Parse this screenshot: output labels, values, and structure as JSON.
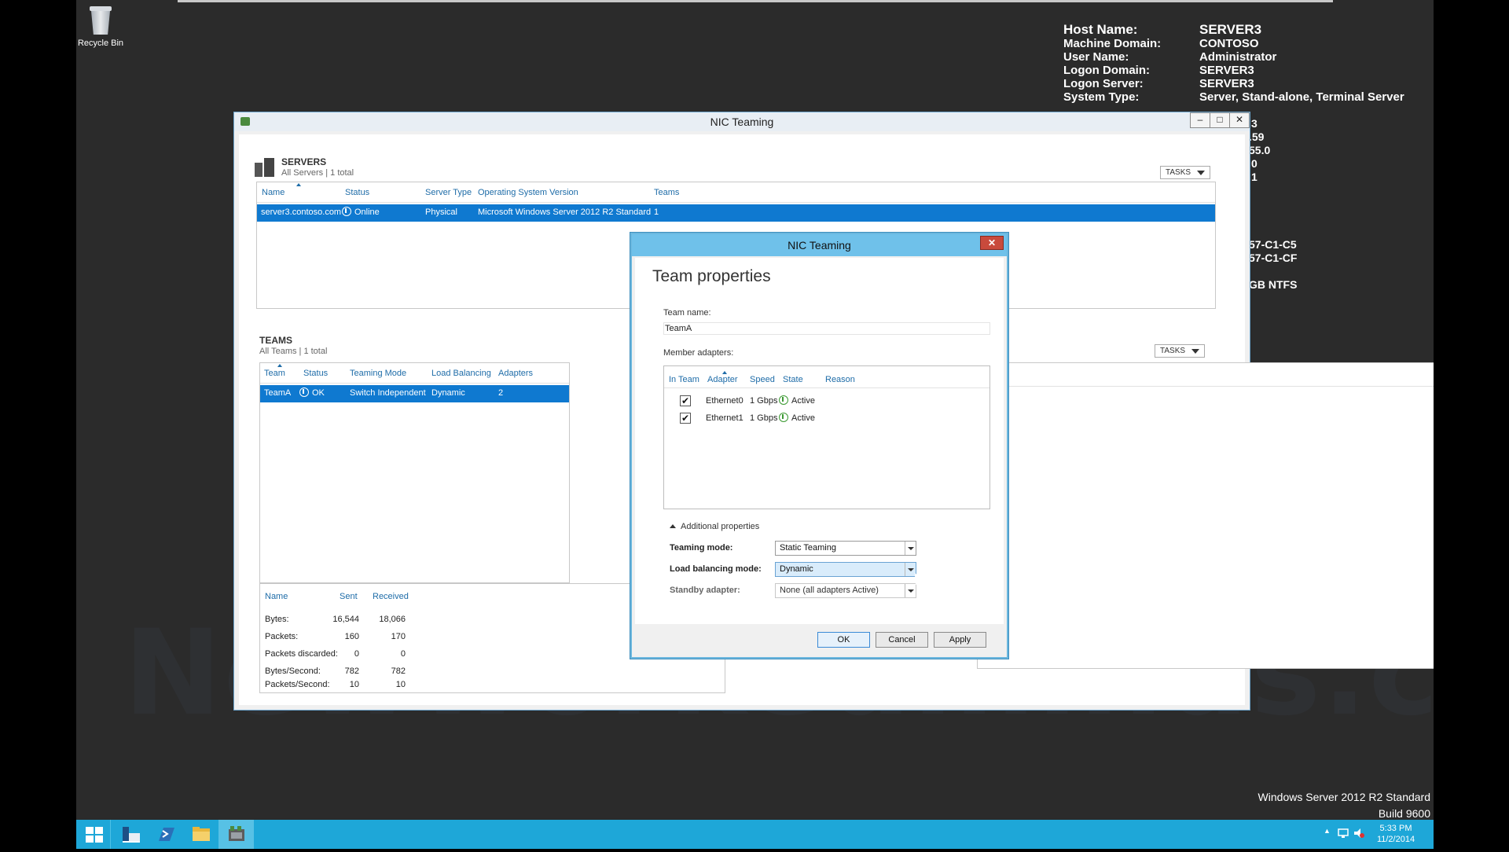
{
  "desktop": {
    "recycle_bin": "Recycle Bin",
    "bginfo": [
      {
        "k": "Host Name:",
        "v": "SERVER3"
      },
      {
        "k": "Machine Domain:",
        "v": "CONTOSO"
      },
      {
        "k": "User Name:",
        "v": "Administrator"
      },
      {
        "k": "Logon Domain:",
        "v": "SERVER3"
      },
      {
        "k": "Logon Server:",
        "v": "SERVER3"
      },
      {
        "k": "System Type:",
        "v": "Server, Stand-alone, Terminal Server"
      }
    ],
    "bginfo_fragments": [
      "3",
      ".59",
      "55.0",
      "0",
      "1",
      "57-C1-C5",
      "57-C1-CF",
      "GB NTFS"
    ],
    "watermark": "Newworkedminds.com",
    "os_name": "Windows Server 2012 R2 Standard",
    "os_build": "Build 9600"
  },
  "window": {
    "title": "NIC Teaming",
    "controls": [
      "–",
      "□",
      "✕"
    ]
  },
  "servers": {
    "title": "SERVERS",
    "subtitle": "All Servers | 1 total",
    "tasks": "TASKS",
    "columns": [
      "Name",
      "Status",
      "Server Type",
      "Operating System Version",
      "Teams"
    ],
    "row": {
      "name": "server3.contoso.com",
      "status": "Online",
      "type": "Physical",
      "os": "Microsoft Windows Server 2012 R2 Standard",
      "teams": "1"
    }
  },
  "teams": {
    "title": "TEAMS",
    "subtitle": "All Teams | 1 total",
    "tasks": "TASKS",
    "columns": [
      "Team",
      "Status",
      "Teaming Mode",
      "Load Balancing",
      "Adapters"
    ],
    "row": {
      "team": "TeamA",
      "status": "OK",
      "mode": "Switch Independent",
      "lb": "Dynamic",
      "adapters": "2"
    }
  },
  "stats": {
    "columns": [
      "Name",
      "Sent",
      "Received"
    ],
    "rows": [
      {
        "name": "Bytes:",
        "sent": "16,544",
        "received": "18,066"
      },
      {
        "name": "Packets:",
        "sent": "160",
        "received": "170"
      },
      {
        "name": "Packets discarded:",
        "sent": "0",
        "received": "0"
      },
      {
        "name": "Bytes/Second:",
        "sent": "782",
        "received": "782"
      },
      {
        "name": "Packets/Second:",
        "sent": "10",
        "received": "10"
      }
    ]
  },
  "dialog": {
    "title": "NIC Teaming",
    "close": "✕",
    "heading": "Team properties",
    "team_name_label": "Team name:",
    "team_name_value": "TeamA",
    "member_adapters_label": "Member adapters:",
    "adapter_columns": [
      "In Team",
      "Adapter",
      "Speed",
      "State",
      "Reason"
    ],
    "adapters": [
      {
        "checked": "✔",
        "name": "Ethernet0",
        "speed": "1 Gbps",
        "state": "Active",
        "reason": ""
      },
      {
        "checked": "✔",
        "name": "Ethernet1",
        "speed": "1 Gbps",
        "state": "Active",
        "reason": ""
      }
    ],
    "additional_properties": "Additional properties",
    "teaming_mode_label": "Teaming mode:",
    "teaming_mode_value": "Static Teaming",
    "load_balancing_label": "Load balancing mode:",
    "load_balancing_value": "Dynamic",
    "standby_label": "Standby adapter:",
    "standby_value": "None (all adapters Active)",
    "buttons": {
      "ok": "OK",
      "cancel": "Cancel",
      "apply": "Apply"
    }
  },
  "taskbar": {
    "time": "5:33 PM",
    "date": "11/2/2014"
  },
  "colors": {
    "accent": "#0f79d0",
    "taskbar": "#1ea7d8",
    "dialog_title": "#6fc1ea",
    "desktop": "#2b2b2b"
  }
}
